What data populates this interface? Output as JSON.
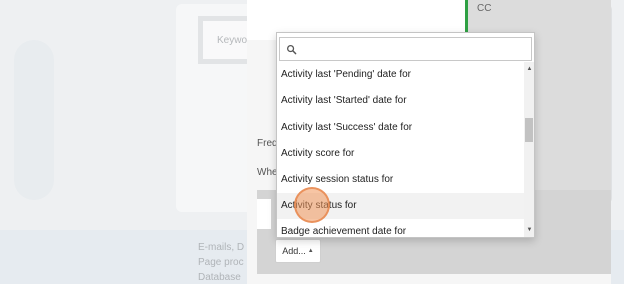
{
  "background": {
    "keyword_placeholder": "Keywo",
    "notes": [
      "E-mails, D",
      "Page proc",
      "Database"
    ]
  },
  "modal": {
    "cc_label": "CC",
    "frequency_label": "Freq",
    "when_label": "When",
    "add_button_label": "Add...",
    "accent_color": "#2ea043"
  },
  "dropdown": {
    "search_placeholder": "",
    "items": [
      "Activity last 'Pending' date for",
      "Activity last 'Started' date for",
      "Activity last 'Success' date for",
      "Activity score for",
      "Activity session status for",
      "Activity status for",
      "Badge achievement date for"
    ],
    "hovered_index": 5
  },
  "icons": {
    "search": "search-icon",
    "scroll_up": "scroll-up-icon",
    "scroll_down": "scroll-down-icon",
    "add_arrow": "caret-up-icon"
  }
}
